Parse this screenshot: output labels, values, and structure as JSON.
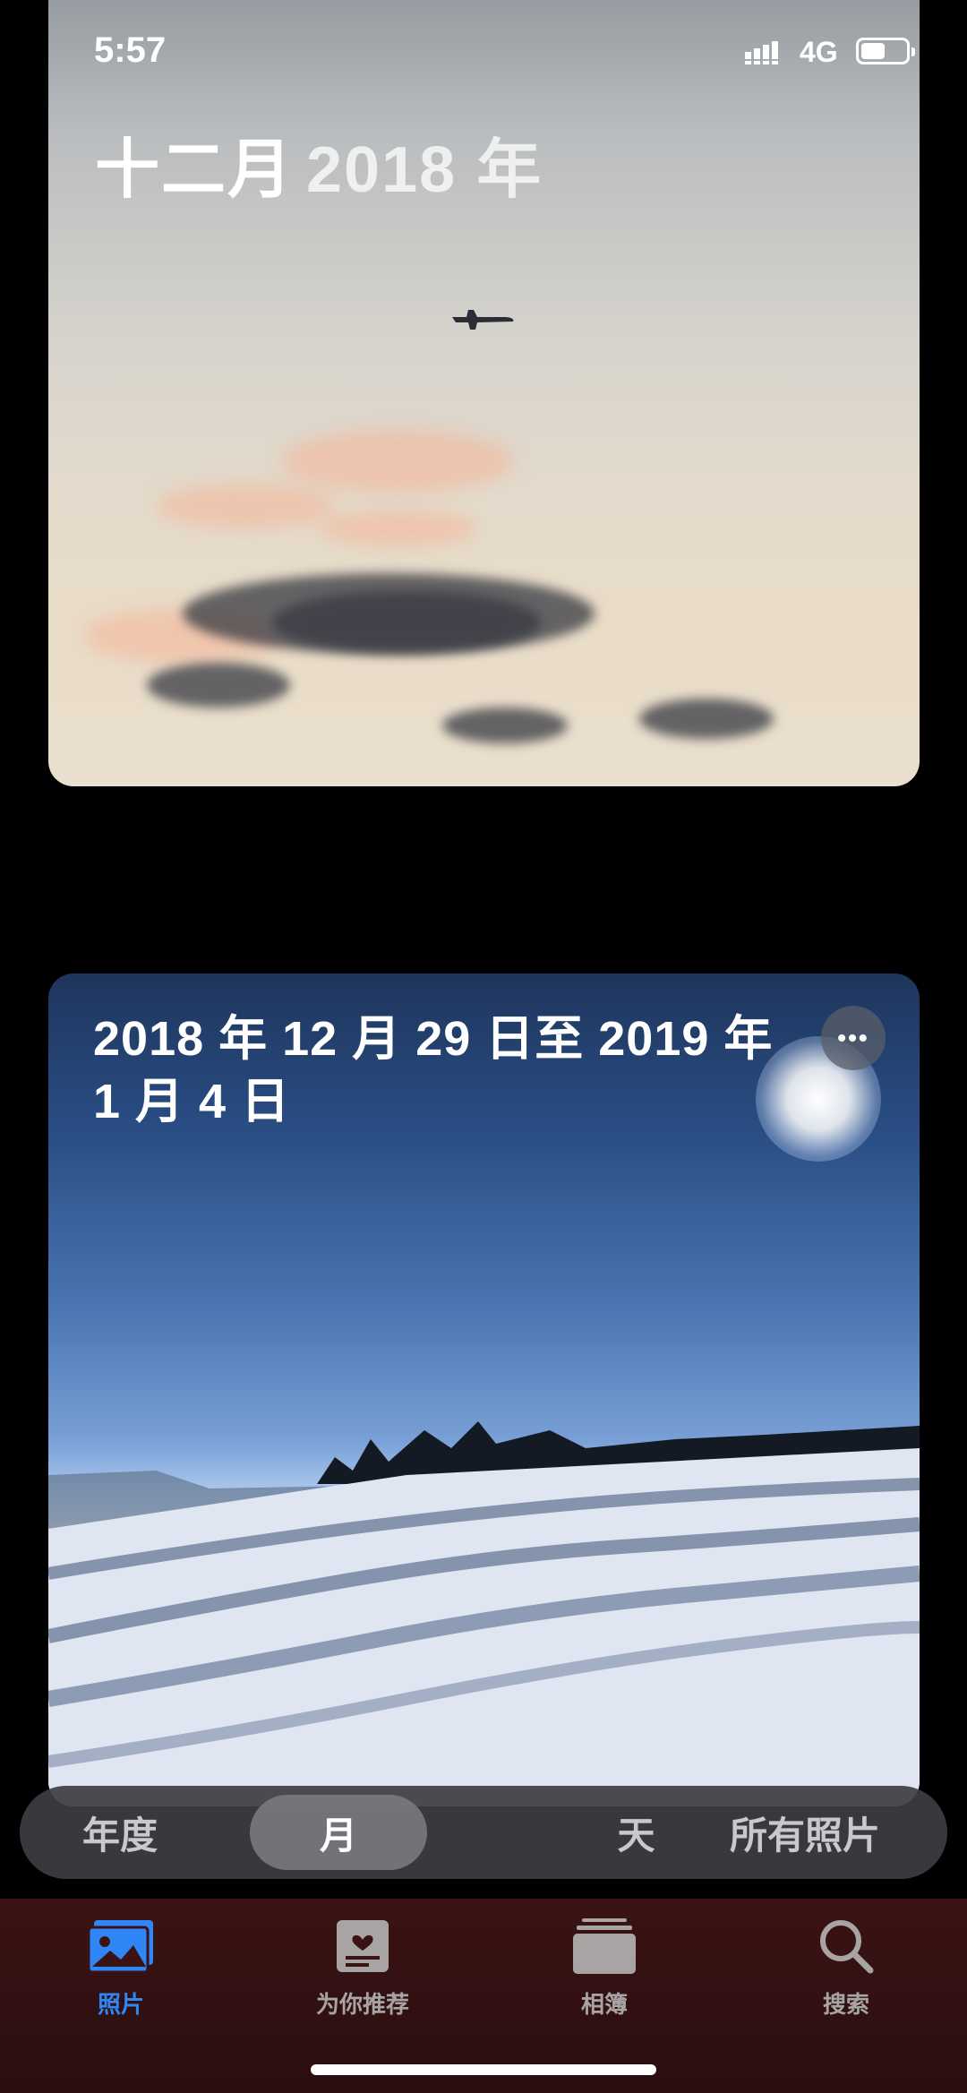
{
  "status_bar": {
    "time": "5:57",
    "network": "4G",
    "battery_level": 0.55
  },
  "cards": [
    {
      "title_month": "十二月",
      "title_year": "2018 年"
    },
    {
      "title": "2018 年 12 月 29 日至 2019 年 1 月 4 日",
      "more_label": "•••"
    }
  ],
  "segment": {
    "items": [
      "年度",
      "月",
      "天",
      "所有照片"
    ],
    "selected": "月"
  },
  "tabbar": {
    "items": [
      {
        "label": "照片",
        "icon": "photos-icon",
        "active": true
      },
      {
        "label": "为你推荐",
        "icon": "for-you-icon",
        "active": false
      },
      {
        "label": "相簿",
        "icon": "albums-icon",
        "active": false
      },
      {
        "label": "搜索",
        "icon": "search-icon",
        "active": false
      }
    ],
    "active_color": "#2f86f6"
  }
}
